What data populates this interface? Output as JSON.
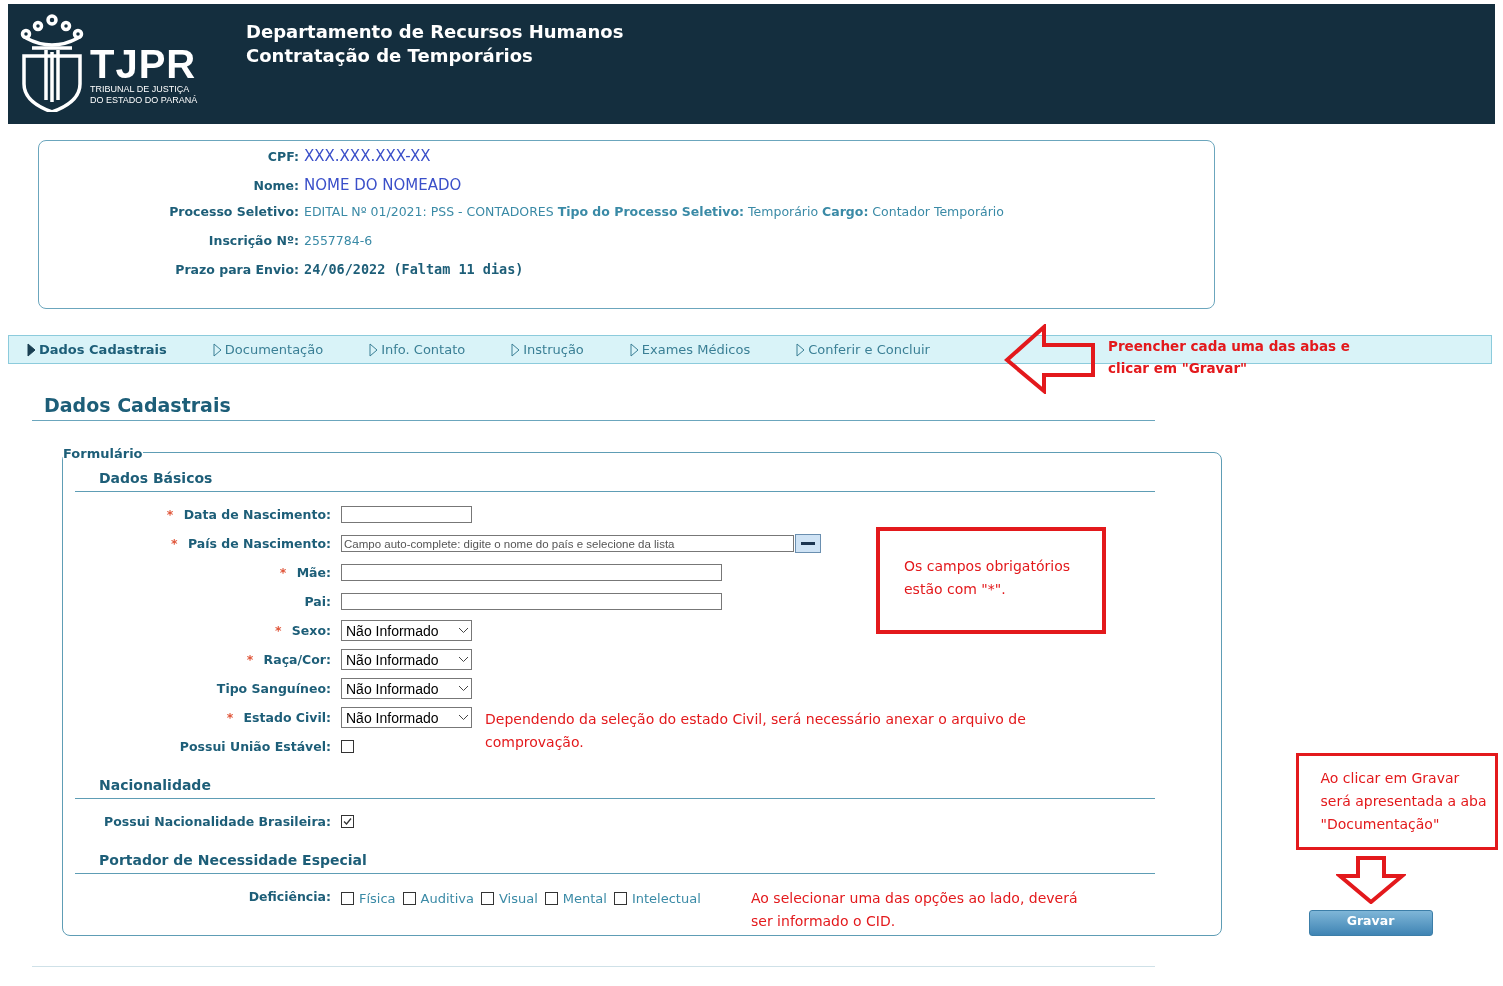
{
  "header": {
    "logo": {
      "name": "TJPR",
      "line1": "TRIBUNAL DE JUSTIÇA",
      "line2": "DO ESTADO DO PARANÁ"
    },
    "title": "Departamento de Recursos Humanos",
    "subtitle": "Contratação de Temporários"
  },
  "info": [
    {
      "label": "CPF:",
      "value": "XXX.XXX.XXX-XX",
      "kind": "highlight"
    },
    {
      "label": "Nome:",
      "value": "NOME DO NOMEADO",
      "kind": "highlight"
    },
    {
      "label": "Processo Seletivo:",
      "value": "EDITAL Nº 01/2021: PSS - CONTADORES **Tipo do Processo Seletivo:** Temporário **Cargo:** Contador Temporário",
      "kind": "plain"
    },
    {
      "label": "Inscrição Nº:",
      "value": "2557784-6",
      "kind": "plain"
    },
    {
      "label": "Prazo para Envio:",
      "value": "24/06/2022 (Faltam 11 dias)",
      "kind": "deadline"
    }
  ],
  "tabs": [
    {
      "label": "Dados Cadastrais",
      "selected": true
    },
    {
      "label": "Documentação",
      "selected": false
    },
    {
      "label": "Info. Contato",
      "selected": false
    },
    {
      "label": "Instrução",
      "selected": false
    },
    {
      "label": "Exames Médicos",
      "selected": false
    },
    {
      "label": "Conferir e Concluir",
      "selected": false
    }
  ],
  "tabs_note": "Preencher cada uma das abas e clicar em \"Gravar\"",
  "page_title": "Dados Cadastrais",
  "form": {
    "legend": "Formulário",
    "required_note": "Os campos obrigatórios estão com \"*\".",
    "sections": [
      {
        "title": "Dados Básicos",
        "rows": [
          {
            "label": "Data de Nascimento:",
            "mark": "*",
            "kind": "date"
          },
          {
            "label": "País de Nascimento:",
            "mark": "*",
            "kind": "autocomplete",
            "placeholder": "Campo auto-complete: digite o nome do país e selecione da lista"
          },
          {
            "label": "Mãe:",
            "mark": "*",
            "kind": "text"
          },
          {
            "label": "Pai:",
            "kind": "text"
          },
          {
            "label": "Sexo:",
            "mark": "*",
            "kind": "select",
            "value": "Não Informado"
          },
          {
            "label": "Raça/Cor:",
            "mark": "*",
            "kind": "select",
            "value": "Não Informado"
          },
          {
            "label": "Tipo Sanguíneo:",
            "kind": "select",
            "value": "Não Informado"
          },
          {
            "label": "Estado Civil:",
            "mark": "*",
            "kind": "select",
            "value": "Não Informado",
            "note": "Dependendo da seleção do estado Civil, será necessário anexar o arquivo de comprovação."
          },
          {
            "label": "Possui União Estável:",
            "kind": "checkbox",
            "checked": false
          }
        ]
      },
      {
        "title": "Nacionalidade",
        "rows": [
          {
            "label": "Possui Nacionalidade Brasileira:",
            "kind": "checkbox",
            "checked": true
          }
        ]
      },
      {
        "title": "Portador de Necessidade Especial",
        "rows": [
          {
            "label": "Deficiência:",
            "kind": "checkgroup",
            "options": [
              {
                "label": "Física",
                "checked": false
              },
              {
                "label": "Auditiva",
                "checked": false
              },
              {
                "label": "Visual",
                "checked": false
              },
              {
                "label": "Mental",
                "checked": false
              },
              {
                "label": "Intelectual",
                "checked": false
              }
            ],
            "note": "Ao selecionar uma das opções ao lado, deverá ser informado o CID."
          }
        ]
      }
    ]
  },
  "save_note": "Ao clicar em Gravar será apresentada a aba \"Documentação\"",
  "save_button": "Gravar"
}
